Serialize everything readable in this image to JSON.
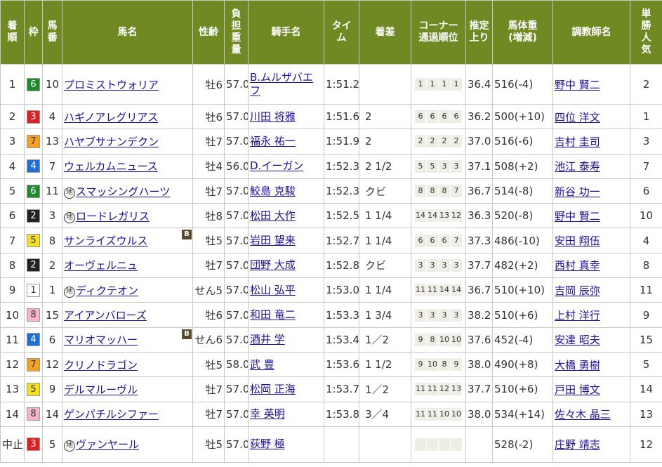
{
  "headers": {
    "rank": "着順",
    "frame": "枠",
    "num": "馬番",
    "horse": "馬名",
    "sexage": "性齢",
    "weight": "負担重量",
    "jockey": "騎手名",
    "time": "タイム",
    "margin": "着差",
    "corner_l1": "コーナー",
    "corner_l2": "通過順位",
    "last3f": "推定上り",
    "bw_l1": "馬体重",
    "bw_l2": "(増減)",
    "trainer": "調教師名",
    "pop": "単勝人気"
  },
  "frame_colors": {
    "1": {
      "bg": "#ffffff",
      "fg": "#333333"
    },
    "2": {
      "bg": "#222222",
      "fg": "#ffffff"
    },
    "3": {
      "bg": "#e02020",
      "fg": "#ffffff"
    },
    "4": {
      "bg": "#1e6fd6",
      "fg": "#ffffff"
    },
    "5": {
      "bg": "#f4e020",
      "fg": "#333333"
    },
    "6": {
      "bg": "#1f8a2a",
      "fg": "#ffffff"
    },
    "7": {
      "bg": "#f5a020",
      "fg": "#333333"
    },
    "8": {
      "bg": "#f7b4c8",
      "fg": "#333333"
    }
  },
  "chihou_mark": "地",
  "blinker_mark": "B",
  "rows": [
    {
      "rank": "1",
      "frame": "6",
      "num": "10",
      "chihou": false,
      "blinker": false,
      "horse": "プロミストウォリア",
      "sexage": "牡6",
      "weight": "57.0",
      "jockey": "B.ムルザバエフ",
      "time": "1:51.2",
      "margin": "",
      "corners": [
        "1",
        "1",
        "1",
        "1"
      ],
      "last3f": "36.4",
      "bodyweight": "516(-4)",
      "trainer": "野中 賢二",
      "pop": "2"
    },
    {
      "rank": "2",
      "frame": "3",
      "num": "4",
      "chihou": false,
      "blinker": false,
      "horse": "ハギノアレグリアス",
      "sexage": "牡6",
      "weight": "57.0",
      "jockey": "川田 将雅",
      "time": "1:51.6",
      "margin": "2",
      "corners": [
        "6",
        "6",
        "6",
        "6"
      ],
      "last3f": "36.2",
      "bodyweight": "500(+10)",
      "trainer": "四位 洋文",
      "pop": "1"
    },
    {
      "rank": "3",
      "frame": "7",
      "num": "13",
      "chihou": false,
      "blinker": false,
      "horse": "ハヤブサナンデクン",
      "sexage": "牡7",
      "weight": "57.0",
      "jockey": "福永 祐一",
      "time": "1:51.9",
      "margin": "2",
      "corners": [
        "2",
        "2",
        "2",
        "2"
      ],
      "last3f": "37.0",
      "bodyweight": "516(-6)",
      "trainer": "吉村 圭司",
      "pop": "3"
    },
    {
      "rank": "4",
      "frame": "4",
      "num": "7",
      "chihou": false,
      "blinker": false,
      "horse": "ウェルカムニュース",
      "sexage": "牡4",
      "weight": "56.0",
      "jockey": "D.イーガン",
      "time": "1:52.3",
      "margin": "2 1/2",
      "corners": [
        "5",
        "5",
        "3",
        "3"
      ],
      "last3f": "37.1",
      "bodyweight": "508(+2)",
      "trainer": "池江 泰寿",
      "pop": "7"
    },
    {
      "rank": "5",
      "frame": "6",
      "num": "11",
      "chihou": true,
      "blinker": false,
      "horse": "スマッシングハーツ",
      "sexage": "牡7",
      "weight": "57.0",
      "jockey": "鮫島 克駿",
      "time": "1:52.3",
      "margin": "クビ",
      "corners": [
        "8",
        "8",
        "8",
        "7"
      ],
      "last3f": "36.7",
      "bodyweight": "514(-8)",
      "trainer": "新谷 功一",
      "pop": "6"
    },
    {
      "rank": "6",
      "frame": "2",
      "num": "3",
      "chihou": true,
      "blinker": false,
      "horse": "ロードレガリス",
      "sexage": "牡8",
      "weight": "57.0",
      "jockey": "松田 大作",
      "time": "1:52.5",
      "margin": "1 1/4",
      "corners": [
        "14",
        "14",
        "13",
        "12"
      ],
      "last3f": "36.3",
      "bodyweight": "520(-8)",
      "trainer": "野中 賢二",
      "pop": "10"
    },
    {
      "rank": "7",
      "frame": "5",
      "num": "8",
      "chihou": false,
      "blinker": true,
      "horse": "サンライズウルス",
      "sexage": "牡5",
      "weight": "57.0",
      "jockey": "岩田 望来",
      "time": "1:52.7",
      "margin": "1 1/4",
      "corners": [
        "6",
        "6",
        "6",
        "7"
      ],
      "last3f": "37.3",
      "bodyweight": "486(-10)",
      "trainer": "安田 翔伍",
      "pop": "4"
    },
    {
      "rank": "8",
      "frame": "2",
      "num": "2",
      "chihou": false,
      "blinker": false,
      "horse": "オーヴェルニュ",
      "sexage": "牡7",
      "weight": "57.0",
      "jockey": "団野 大成",
      "time": "1:52.8",
      "margin": "クビ",
      "corners": [
        "3",
        "3",
        "3",
        "3"
      ],
      "last3f": "37.7",
      "bodyweight": "482(+2)",
      "trainer": "西村 真幸",
      "pop": "8"
    },
    {
      "rank": "9",
      "frame": "1",
      "num": "1",
      "chihou": true,
      "blinker": false,
      "horse": "ディクテオン",
      "sexage": "せん5",
      "weight": "57.0",
      "jockey": "松山 弘平",
      "time": "1:53.0",
      "margin": "1 1/4",
      "corners": [
        "11",
        "11",
        "14",
        "14"
      ],
      "last3f": "36.7",
      "bodyweight": "510(+10)",
      "trainer": "吉岡 辰弥",
      "pop": "11"
    },
    {
      "rank": "10",
      "frame": "8",
      "num": "15",
      "chihou": false,
      "blinker": false,
      "horse": "アイアンバローズ",
      "sexage": "牡6",
      "weight": "57.0",
      "jockey": "和田 竜二",
      "time": "1:53.3",
      "margin": "1 3/4",
      "corners": [
        "3",
        "3",
        "3",
        "3"
      ],
      "last3f": "38.2",
      "bodyweight": "510(+6)",
      "trainer": "上村 洋行",
      "pop": "9"
    },
    {
      "rank": "11",
      "frame": "4",
      "num": "6",
      "chihou": false,
      "blinker": true,
      "horse": "マリオマッハー",
      "sexage": "せん6",
      "weight": "57.0",
      "jockey": "酒井 学",
      "time": "1:53.4",
      "margin": "1／2",
      "corners": [
        "9",
        "8",
        "10",
        "10"
      ],
      "last3f": "37.6",
      "bodyweight": "452(-4)",
      "trainer": "安達 昭夫",
      "pop": "15"
    },
    {
      "rank": "12",
      "frame": "7",
      "num": "12",
      "chihou": false,
      "blinker": false,
      "horse": "クリノドラゴン",
      "sexage": "牡5",
      "weight": "58.0",
      "jockey": "武 豊",
      "time": "1:53.6",
      "margin": "1 1/2",
      "corners": [
        "9",
        "10",
        "8",
        "9"
      ],
      "last3f": "38.0",
      "bodyweight": "490(+8)",
      "trainer": "大橋 勇樹",
      "pop": "5"
    },
    {
      "rank": "13",
      "frame": "5",
      "num": "9",
      "chihou": false,
      "blinker": false,
      "horse": "デルマルーヴル",
      "sexage": "牡7",
      "weight": "57.0",
      "jockey": "松岡 正海",
      "time": "1:53.7",
      "margin": "1／2",
      "corners": [
        "11",
        "11",
        "12",
        "13"
      ],
      "last3f": "37.7",
      "bodyweight": "510(+6)",
      "trainer": "戸田 博文",
      "pop": "14"
    },
    {
      "rank": "14",
      "frame": "8",
      "num": "14",
      "chihou": false,
      "blinker": false,
      "horse": "ゲンパチルシファー",
      "sexage": "牡7",
      "weight": "57.0",
      "jockey": "幸 英明",
      "time": "1:53.8",
      "margin": "3／4",
      "corners": [
        "11",
        "11",
        "10",
        "10"
      ],
      "last3f": "38.0",
      "bodyweight": "534(+14)",
      "trainer": "佐々木 晶三",
      "pop": "13"
    },
    {
      "rank": "中止",
      "frame": "3",
      "num": "5",
      "chihou": true,
      "blinker": false,
      "horse": "ヴァンヤール",
      "sexage": "牡5",
      "weight": "57.0",
      "jockey": "荻野 極",
      "time": "",
      "margin": "",
      "corners": [
        "",
        "",
        "",
        ""
      ],
      "last3f": "",
      "bodyweight": "528(-2)",
      "trainer": "庄野 靖志",
      "pop": "12"
    }
  ]
}
